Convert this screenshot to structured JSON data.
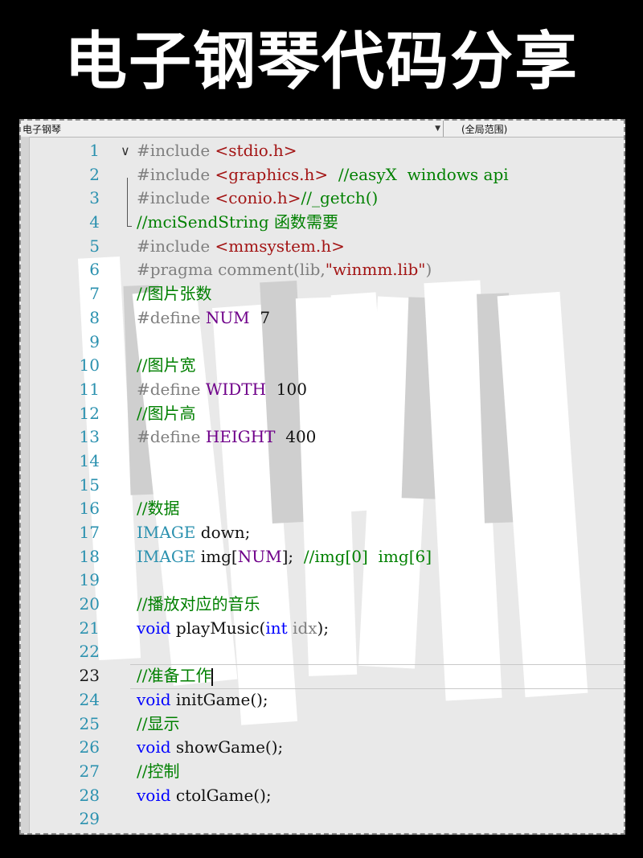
{
  "banner": {
    "title": "电子钢琴代码分享"
  },
  "editor": {
    "nav_left": "电子钢琴",
    "nav_dropdown_icon": "▼",
    "nav_right": "(全局范围)",
    "current_line": 23,
    "lines": [
      {
        "n": "1",
        "tokens": [
          {
            "t": "#include ",
            "c": "c-pre"
          },
          {
            "t": "<stdio.h>",
            "c": "c-str"
          }
        ]
      },
      {
        "n": "2",
        "tokens": [
          {
            "t": "#include ",
            "c": "c-pre"
          },
          {
            "t": "<graphics.h>",
            "c": "c-str"
          },
          {
            "t": "  //easyX  windows api",
            "c": "c-com"
          }
        ]
      },
      {
        "n": "3",
        "tokens": [
          {
            "t": "#include ",
            "c": "c-pre"
          },
          {
            "t": "<conio.h>",
            "c": "c-str"
          },
          {
            "t": "//_getch()",
            "c": "c-com"
          }
        ]
      },
      {
        "n": "4",
        "tokens": [
          {
            "t": "//mciSendString 函数需要",
            "c": "c-com"
          }
        ]
      },
      {
        "n": "5",
        "tokens": [
          {
            "t": "#include ",
            "c": "c-pre"
          },
          {
            "t": "<mmsystem.h>",
            "c": "c-str"
          }
        ]
      },
      {
        "n": "6",
        "tokens": [
          {
            "t": "#pragma ",
            "c": "c-pre"
          },
          {
            "t": "comment(lib,",
            "c": "c-pre"
          },
          {
            "t": "\"winmm.lib\"",
            "c": "c-str"
          },
          {
            "t": ")",
            "c": "c-pre"
          }
        ]
      },
      {
        "n": "7",
        "tokens": [
          {
            "t": "//图片张数",
            "c": "c-com"
          }
        ]
      },
      {
        "n": "8",
        "tokens": [
          {
            "t": "#define ",
            "c": "c-pre"
          },
          {
            "t": "NUM",
            "c": "c-mac"
          },
          {
            "t": "  7",
            "c": "c-plain"
          }
        ]
      },
      {
        "n": "9",
        "tokens": []
      },
      {
        "n": "10",
        "tokens": [
          {
            "t": "//图片宽",
            "c": "c-com"
          }
        ]
      },
      {
        "n": "11",
        "tokens": [
          {
            "t": "#define ",
            "c": "c-pre"
          },
          {
            "t": "WIDTH",
            "c": "c-mac"
          },
          {
            "t": "  100",
            "c": "c-plain"
          }
        ]
      },
      {
        "n": "12",
        "tokens": [
          {
            "t": "//图片高",
            "c": "c-com"
          }
        ]
      },
      {
        "n": "13",
        "tokens": [
          {
            "t": "#define ",
            "c": "c-pre"
          },
          {
            "t": "HEIGHT",
            "c": "c-mac"
          },
          {
            "t": "  400",
            "c": "c-plain"
          }
        ]
      },
      {
        "n": "14",
        "tokens": []
      },
      {
        "n": "15",
        "tokens": []
      },
      {
        "n": "16",
        "tokens": [
          {
            "t": "//数据",
            "c": "c-com"
          }
        ]
      },
      {
        "n": "17",
        "tokens": [
          {
            "t": "IMAGE",
            "c": "c-type"
          },
          {
            "t": " down;",
            "c": "c-plain"
          }
        ]
      },
      {
        "n": "18",
        "tokens": [
          {
            "t": "IMAGE",
            "c": "c-type"
          },
          {
            "t": " img[",
            "c": "c-plain"
          },
          {
            "t": "NUM",
            "c": "c-mac"
          },
          {
            "t": "];  ",
            "c": "c-plain"
          },
          {
            "t": "//img[0]  img[6]",
            "c": "c-com"
          }
        ]
      },
      {
        "n": "19",
        "tokens": []
      },
      {
        "n": "20",
        "tokens": [
          {
            "t": "//播放对应的音乐",
            "c": "c-com"
          }
        ]
      },
      {
        "n": "21",
        "tokens": [
          {
            "t": "void",
            "c": "c-kw"
          },
          {
            "t": " playMusic(",
            "c": "c-plain"
          },
          {
            "t": "int",
            "c": "c-kw"
          },
          {
            "t": " idx",
            "c": "c-param"
          },
          {
            "t": ");",
            "c": "c-plain"
          }
        ]
      },
      {
        "n": "22",
        "tokens": []
      },
      {
        "n": "23",
        "tokens": [
          {
            "t": "//准备工作",
            "c": "c-com"
          }
        ]
      },
      {
        "n": "24",
        "tokens": [
          {
            "t": "void",
            "c": "c-kw"
          },
          {
            "t": " initGame();",
            "c": "c-plain"
          }
        ]
      },
      {
        "n": "25",
        "tokens": [
          {
            "t": "//显示",
            "c": "c-com"
          }
        ]
      },
      {
        "n": "26",
        "tokens": [
          {
            "t": "void",
            "c": "c-kw"
          },
          {
            "t": " showGame();",
            "c": "c-plain"
          }
        ]
      },
      {
        "n": "27",
        "tokens": [
          {
            "t": "//控制",
            "c": "c-com"
          }
        ]
      },
      {
        "n": "28",
        "tokens": [
          {
            "t": "void",
            "c": "c-kw"
          },
          {
            "t": " ctolGame();",
            "c": "c-plain"
          }
        ]
      },
      {
        "n": "29",
        "tokens": []
      }
    ]
  }
}
